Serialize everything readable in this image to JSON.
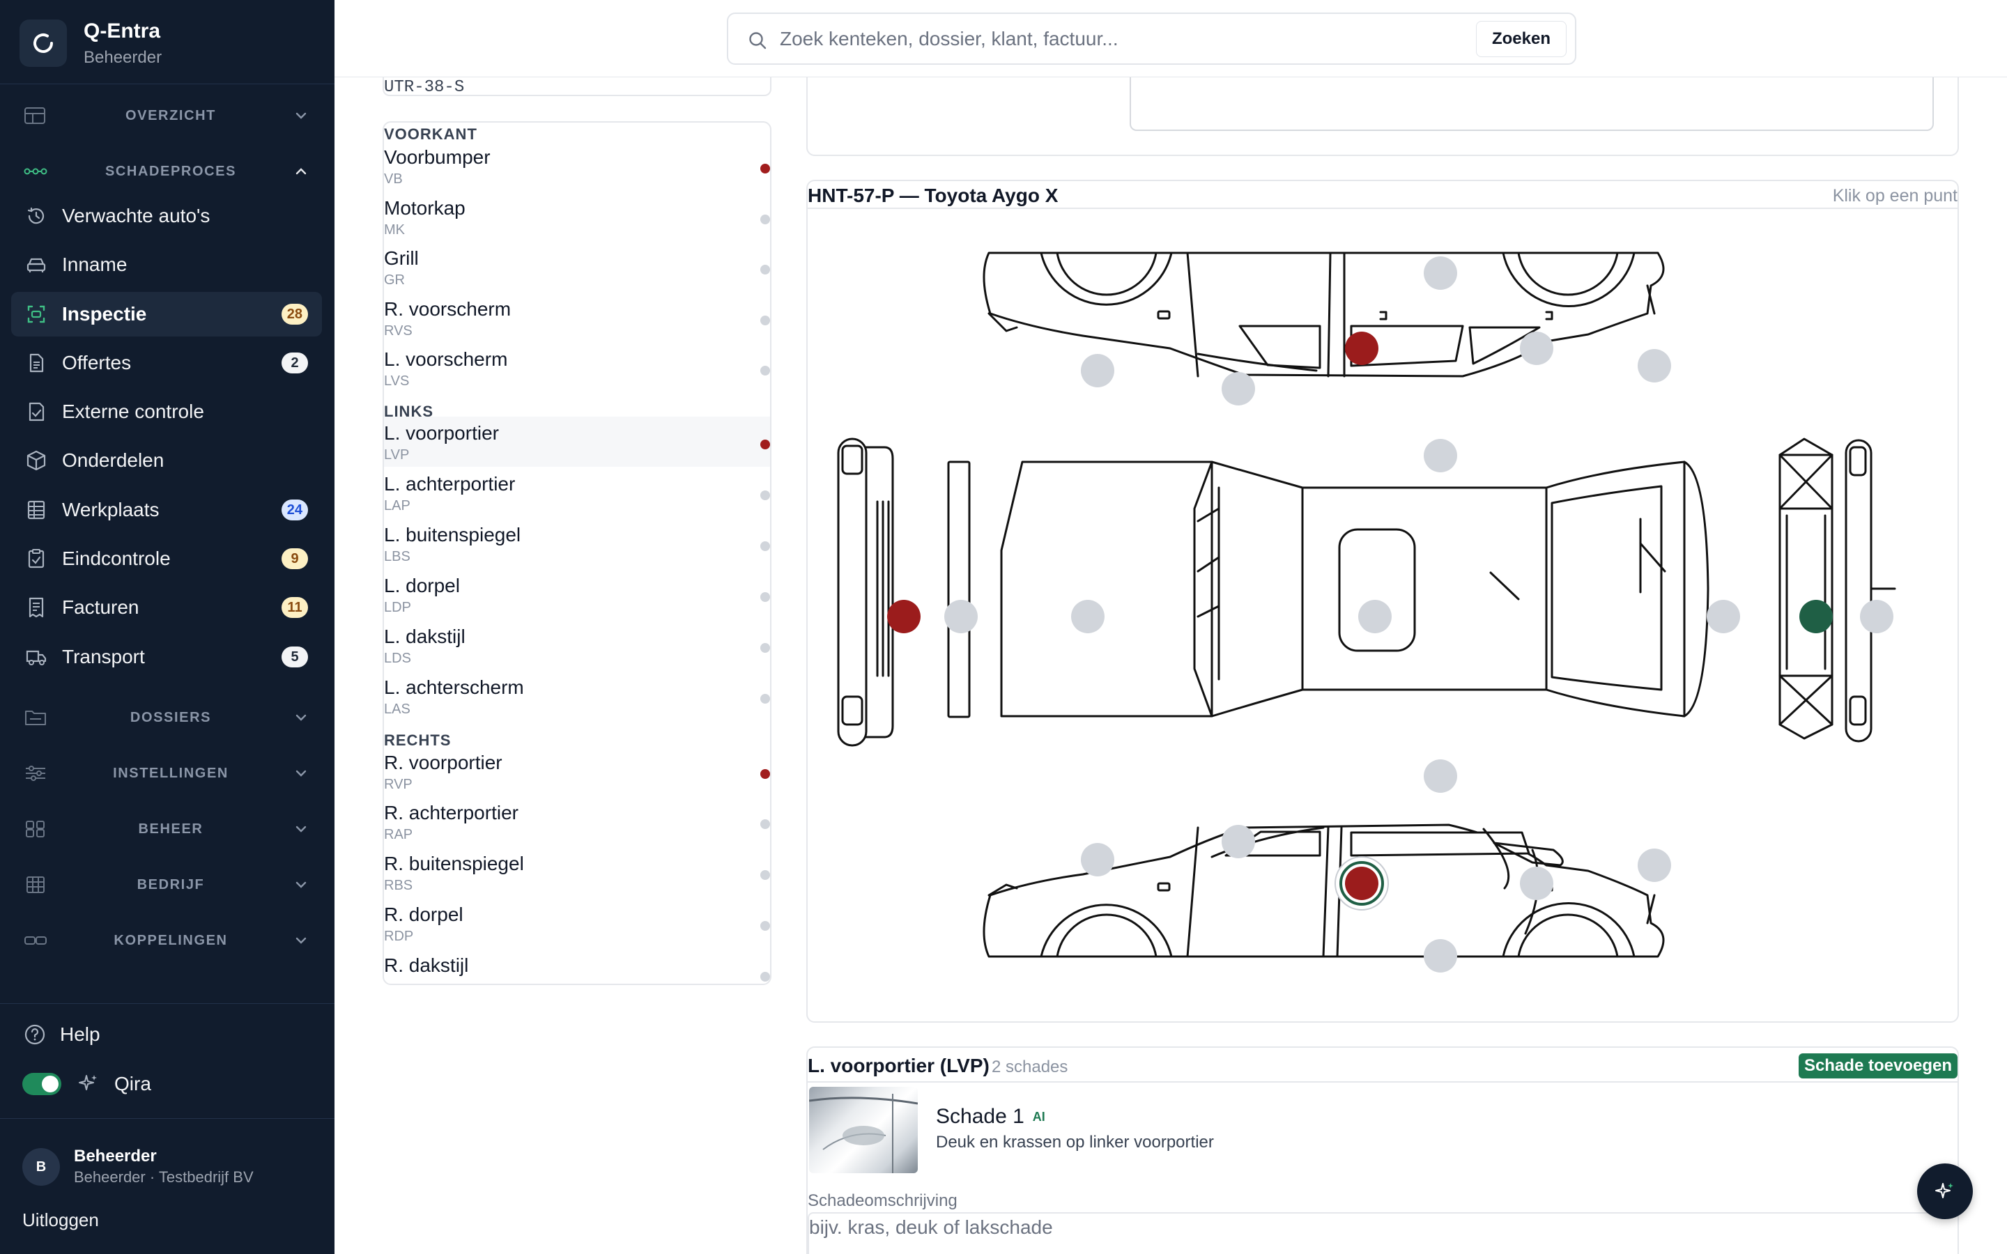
{
  "app": {
    "name": "Q-Entra",
    "role": "Beheerder"
  },
  "search": {
    "placeholder": "Zoek kenteken, dossier, klant, factuur...",
    "button_label": "Zoeken"
  },
  "sidebar": {
    "sections": {
      "overzicht": "OVERZICHT",
      "schadeproces": "SCHADEPROCES",
      "dossiers": "DOSSIERS",
      "instellingen": "INSTELLINGEN",
      "beheer": "BEHEER",
      "bedrijf": "BEDRIJF",
      "koppelingen": "KOPPELINGEN"
    },
    "items": [
      {
        "label": "Verwachte auto's",
        "icon": "clock-history-icon"
      },
      {
        "label": "Inname",
        "icon": "car-front-icon"
      },
      {
        "label": "Inspectie",
        "icon": "scan-icon",
        "badge": "28",
        "active": true
      },
      {
        "label": "Offertes",
        "icon": "document-icon",
        "badge": "2"
      },
      {
        "label": "Externe controle",
        "icon": "document-check-icon"
      },
      {
        "label": "Onderdelen",
        "icon": "box-icon"
      },
      {
        "label": "Werkplaats",
        "icon": "table-icon",
        "badge": "24"
      },
      {
        "label": "Eindcontrole",
        "icon": "clipboard-check-icon",
        "badge": "9"
      },
      {
        "label": "Facturen",
        "icon": "receipt-icon",
        "badge": "11"
      },
      {
        "label": "Transport",
        "icon": "truck-icon",
        "badge": "5"
      }
    ],
    "help_label": "Help",
    "qira_label": "Qira",
    "user": {
      "initial": "B",
      "name": "Beheerder",
      "subtitle": "Beheerder · Testbedrijf BV"
    },
    "logout_label": "Uitloggen"
  },
  "parts_top_value": "UTR-38-S",
  "parts": {
    "groups": [
      {
        "title": "VOORKANT",
        "items": [
          {
            "name": "Voorbumper",
            "code": "VB",
            "damaged": true
          },
          {
            "name": "Motorkap",
            "code": "MK",
            "damaged": false
          },
          {
            "name": "Grill",
            "code": "GR",
            "damaged": false
          },
          {
            "name": "R. voorscherm",
            "code": "RVS",
            "damaged": false
          },
          {
            "name": "L. voorscherm",
            "code": "LVS",
            "damaged": false
          }
        ]
      },
      {
        "title": "LINKS",
        "items": [
          {
            "name": "L. voorportier",
            "code": "LVP",
            "damaged": true,
            "selected": true
          },
          {
            "name": "L. achterportier",
            "code": "LAP",
            "damaged": false
          },
          {
            "name": "L. buitenspiegel",
            "code": "LBS",
            "damaged": false
          },
          {
            "name": "L. dorpel",
            "code": "LDP",
            "damaged": false
          },
          {
            "name": "L. dakstijl",
            "code": "LDS",
            "damaged": false
          },
          {
            "name": "L. achterscherm",
            "code": "LAS",
            "damaged": false
          }
        ]
      },
      {
        "title": "RECHTS",
        "items": [
          {
            "name": "R. voorportier",
            "code": "RVP",
            "damaged": true
          },
          {
            "name": "R. achterportier",
            "code": "RAP",
            "damaged": false
          },
          {
            "name": "R. buitenspiegel",
            "code": "RBS",
            "damaged": false
          },
          {
            "name": "R. dorpel",
            "code": "RDP",
            "damaged": false
          },
          {
            "name": "R. dakstijl",
            "code": "",
            "damaged": false
          }
        ]
      }
    ]
  },
  "diagram": {
    "title": "HNT-57-P — Toyota Aygo X",
    "hint": "Klik op een punt",
    "colors": {
      "damaged": "#9b1c1c",
      "selected": "#1f5f45",
      "neutral": "#d1d5db"
    }
  },
  "damage": {
    "title": "L. voorportier (LVP)",
    "count": "2 schades",
    "add_label": "Schade toevoegen",
    "item": {
      "name": "Schade 1",
      "ai_tag": "AI",
      "description": "Deuk en krassen op linker voorportier"
    },
    "description_label": "Schadeomschrijving",
    "description_placeholder": "bijv. kras, deuk of lakschade"
  }
}
